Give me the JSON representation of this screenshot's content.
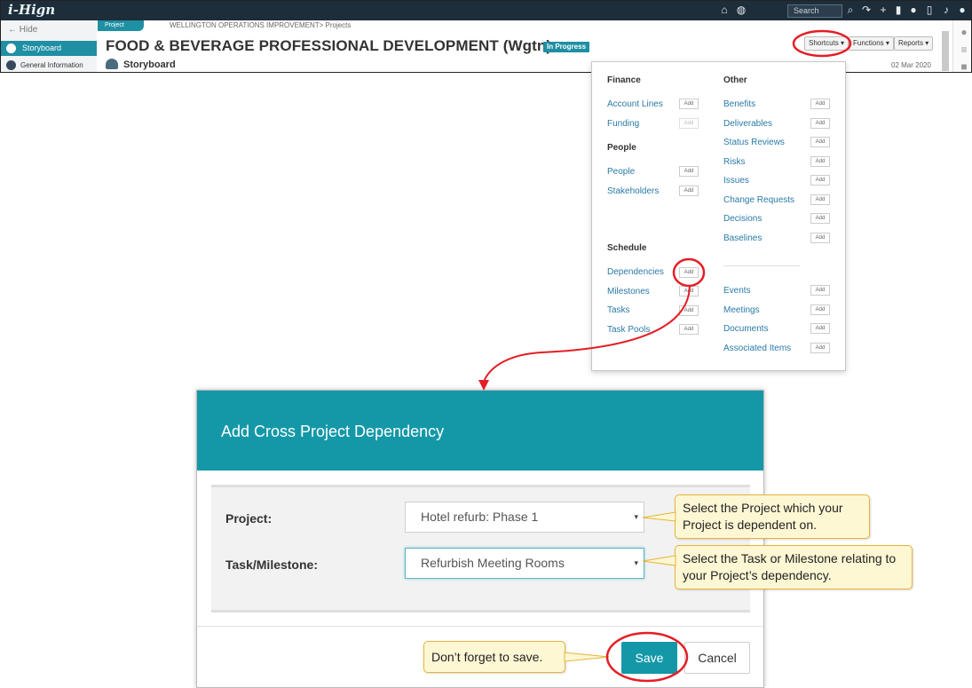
{
  "app": {
    "logo": "i-Hign",
    "search_placeholder": "Search",
    "sidebar": {
      "hide": "← Hide",
      "items": [
        "Storyboard",
        "General Information"
      ]
    },
    "breadcrumb_tab": "Project",
    "breadcrumb": "WELLINGTON OPERATIONS IMPROVEMENT> Projects",
    "title": "FOOD & BEVERAGE PROFESSIONAL DEVELOPMENT (Wgtn)",
    "status": "In Progress",
    "subtitle": "Storyboard",
    "date": "02 Mar 2020",
    "buttons": {
      "shortcuts": "Shortcuts ▾",
      "functions": "Functions ▾",
      "reports": "Reports ▾"
    }
  },
  "shortcuts": {
    "finance_heading": "Finance",
    "finance": [
      "Account Lines",
      "Funding"
    ],
    "people_heading": "People",
    "people": [
      "People",
      "Stakeholders"
    ],
    "schedule_heading": "Schedule",
    "schedule": [
      "Dependencies",
      "Milestones",
      "Tasks",
      "Task Pools"
    ],
    "other_heading": "Other",
    "other_a": [
      "Benefits",
      "Deliverables",
      "Status Reviews",
      "Risks",
      "Issues",
      "Change Requests",
      "Decisions",
      "Baselines"
    ],
    "other_b": [
      "Events",
      "Meetings",
      "Documents",
      "Associated Items"
    ],
    "add_label": "Add"
  },
  "modal": {
    "title": "Add Cross Project Dependency",
    "project_label": "Project:",
    "project_value": "Hotel refurb: Phase 1",
    "task_label": "Task/Milestone:",
    "task_value": "Refurbish Meeting Rooms",
    "caret": "▾",
    "save": "Save",
    "cancel": "Cancel"
  },
  "callouts": {
    "project": "Select the Project which your Project is dependent on.",
    "task": "Select the Task or Milestone relating to your Project’s dependency.",
    "save": "Don’t forget to save."
  },
  "colors": {
    "accent": "#1498a8",
    "annotation": "#e41e26",
    "callout_bg": "#fef7d4",
    "callout_border": "#e6b33a"
  }
}
